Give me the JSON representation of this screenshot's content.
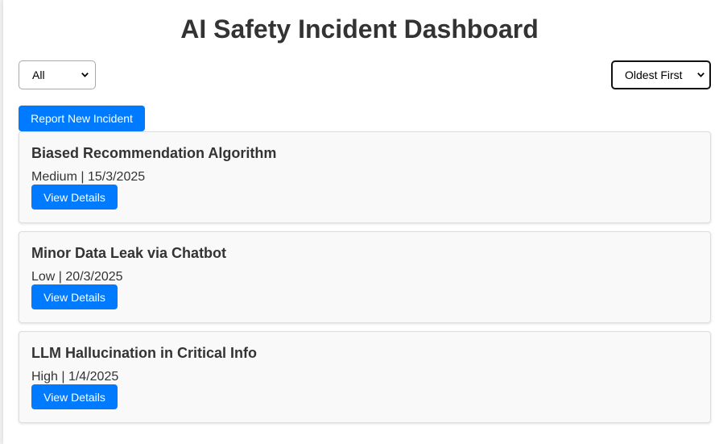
{
  "header": {
    "title": "AI Safety Incident Dashboard"
  },
  "controls": {
    "severity_filter": {
      "selected": "All"
    },
    "sort_order": {
      "selected": "Oldest First"
    },
    "report_button_label": "Report New Incident"
  },
  "incidents": [
    {
      "title": "Biased Recommendation Algorithm",
      "meta": "Medium | 15/3/2025",
      "button_label": "View Details"
    },
    {
      "title": "Minor Data Leak via Chatbot",
      "meta": "Low | 20/3/2025",
      "button_label": "View Details"
    },
    {
      "title": "LLM Hallucination in Critical Info",
      "meta": "High | 1/4/2025",
      "button_label": "View Details"
    }
  ],
  "colors": {
    "accent": "#007bff",
    "card_background": "#f9f9f9",
    "text": "#333333"
  }
}
